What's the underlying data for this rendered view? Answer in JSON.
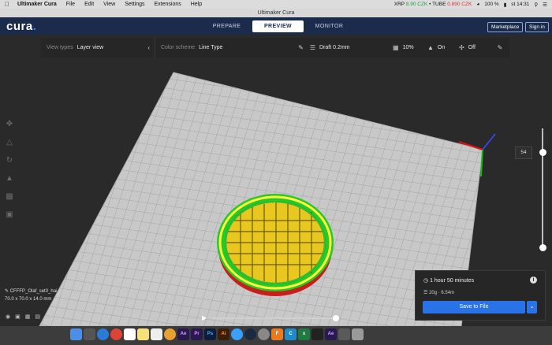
{
  "menubar": {
    "app_name": "Ultimaker Cura",
    "items": [
      "File",
      "Edit",
      "View",
      "Settings",
      "Extensions",
      "Help"
    ],
    "ticker_xrp_label": "XRP",
    "ticker_xrp_value": "8.90 CZK",
    "ticker_sep": "•",
    "ticker_tube_label": "TUBE",
    "ticker_tube_value": "0.890 CZK",
    "battery": "100 %",
    "clock": "st 14:31"
  },
  "window": {
    "title": "Ultimaker Cura"
  },
  "header": {
    "logo_text": "cura",
    "logo_dot": ".",
    "tabs": [
      {
        "label": "PREPARE",
        "active": false
      },
      {
        "label": "PREVIEW",
        "active": true
      },
      {
        "label": "MONITOR",
        "active": false
      }
    ],
    "marketplace_label": "Marketplace",
    "signin_label": "Sign in"
  },
  "toolbar": {
    "view_types_label": "View types",
    "view_types_value": "Layer view",
    "color_scheme_label": "Color scheme",
    "color_scheme_value": "Line Type",
    "profile": "Draft 0.2mm",
    "infill": "10%",
    "support": "On",
    "adhesion": "Off"
  },
  "layer_slider": {
    "current_layer": "54"
  },
  "object": {
    "name": "CFFFP_Olaf_set0_hai",
    "dimensions": "70.0 x 70.0 x 14.0 mm"
  },
  "print": {
    "time": "1 hour 50 minutes",
    "material": "20g · 6.54m",
    "save_label": "Save to File",
    "info_symbol": "i"
  },
  "colors": {
    "header_bg": "#1a2b4c",
    "accent": "#2a72e8",
    "grid": "#c8c8c8",
    "wall_outer": "#c81e1e",
    "wall_inner": "#28c828",
    "infill": "#e8c81e",
    "skin": "#ffff3c"
  },
  "dock": {
    "apps": [
      "Finder",
      "Launchpad",
      "Safari",
      "Chrome",
      "Calendar",
      "Notes",
      "Reminders",
      "Photos",
      "Ae",
      "Pr",
      "Ps",
      "Ai",
      "Messages",
      "Steam",
      "Preferences",
      "Fusion",
      "Cura",
      "Excel",
      "Terminal",
      "Ae",
      "Downloads",
      "Trash"
    ]
  }
}
